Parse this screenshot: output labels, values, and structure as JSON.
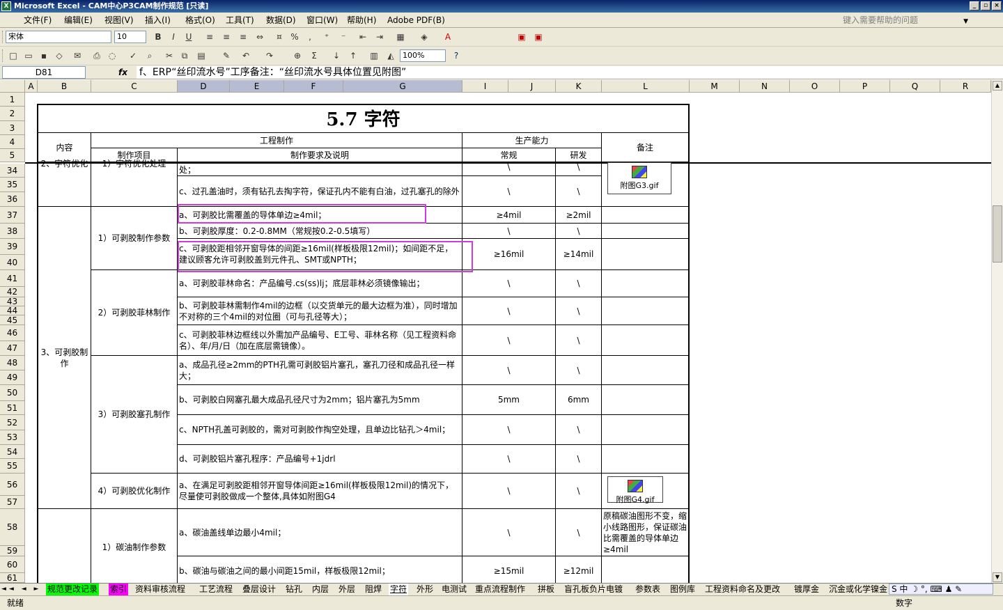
{
  "window": {
    "title": "Microsoft Excel - CAM中心P3CAM制作规范 [只读]",
    "min": "_",
    "max": "▫",
    "close": "×"
  },
  "menu": {
    "items": [
      "文件(F)",
      "编辑(E)",
      "视图(V)",
      "插入(I)",
      "格式(O)",
      "工具(T)",
      "数据(D)",
      "窗口(W)",
      "帮助(H)",
      "Adobe PDF(B)"
    ],
    "help_placeholder": "键入需要帮助的问题"
  },
  "format_toolbar": {
    "font": "宋体",
    "size": "10",
    "bold": "B",
    "italic": "I",
    "underline": "U",
    "percent": "%",
    "comma": ","
  },
  "std_toolbar": {
    "zoom": "100%"
  },
  "formula": {
    "cell": "D81",
    "fx": "fx",
    "content": "f、ERP“丝印流水号”工序备注：“丝印流水号具体位置见附图”"
  },
  "columns": [
    "A",
    "B",
    "C",
    "D",
    "E",
    "F",
    "G",
    "I",
    "J",
    "K",
    "L",
    "M",
    "N",
    "O",
    "P",
    "Q",
    "R"
  ],
  "rows": [
    "1",
    "2",
    "3",
    "4",
    "5",
    "34",
    "35",
    "36",
    "37",
    "38",
    "39",
    "40",
    "41",
    "42",
    "43",
    "44",
    "45",
    "46",
    "47",
    "48",
    "49",
    "50",
    "51",
    "52",
    "53",
    "54",
    "55",
    "56",
    "57",
    "58",
    "59",
    "60",
    "61"
  ],
  "sheet": {
    "title": "5.7 字符",
    "hdr_content": "内容",
    "hdr_eng": "工程制作",
    "hdr_capacity": "生产能力",
    "hdr_remark": "备注",
    "hdr_item": "制作项目",
    "hdr_req": "制作要求及说明",
    "hdr_normal": "常规",
    "hdr_dev": "研发",
    "partial_b": "2、字符优化",
    "partial_c": "1）字符优化处理",
    "r34_req": "处；",
    "r34_n": "\\",
    "r34_d": "\\",
    "r35_req": "c、过孔盖油时，须有钻孔去掏字符，保证孔内不能有白油，过孔塞孔的除外",
    "r35_n": "\\",
    "r35_d": "\\",
    "attach_g3": "附图G3.gif",
    "sec3": "3、可剥胶制作",
    "item1": "1）可剥胶制作参数",
    "r37_req": "a、可剥胶比需覆盖的导体单边≥4mil；",
    "r37_n": "≥4mil",
    "r37_d": "≥2mil",
    "r38_req": "b、可剥胶厚度：0.2-0.8MM（常规按0.2-0.5填写）",
    "r38_n": "\\",
    "r38_d": "\\",
    "r39_req": "c、可剥胶距相邻开窗导体的间距≥16mil(样板极限12mil)；如间距不足，建议顾客允许可剥胶盖到元件孔、SMT或NPTH；",
    "r39_n": "≥16mil",
    "r39_d": "≥14mil",
    "item2": "2）可剥胶菲林制作",
    "r41_req": "a、可剥胶菲林命名：产品编号.cs(ss)lj；底层菲林必须镜像输出；",
    "r41_n": "\\",
    "r41_d": "\\",
    "r44_req": "b、可剥胶菲林需制作4mil的边框（以交货单元的最大边框为准），同时增加不对称的三个4mil的对位圈（可与孔径等大）；",
    "r44_n": "\\",
    "r44_d": "\\",
    "r46_req": "c、可剥胶菲林边框线以外需加产品编号、E工号、菲林名称（见工程资料命名）、年/月/日（加在底层需镜像）。",
    "r46_n": "\\",
    "r46_d": "\\",
    "item3": "3）可剥胶塞孔制作",
    "r48_req": "a、成品孔径≥2mm的PTH孔需可剥胶铝片塞孔，塞孔刀径和成品孔径一样大；",
    "r48_n": "\\",
    "r48_d": "\\",
    "r50_req": "b、可剥胶白网塞孔最大成品孔径尺寸为2mm；铝片塞孔为5mm",
    "r50_n": "5mm",
    "r50_d": "6mm",
    "r52_req": "c、NPTH孔盖可剥胶的，需对可剥胶作掏空处理，且单边比钻孔＞4mil；",
    "r52_n": "\\",
    "r52_d": "\\",
    "r54_req": "d、可剥胶铝片塞孔程序：产品编号+1jdrl",
    "r54_n": "\\",
    "r54_d": "\\",
    "item4": "4）可剥胶优化制作",
    "r56_req": "a、在满足可剥胶距相邻开窗导体间距≥16mil(样板极限12mil)的情况下，尽量使可剥胶做成一个整体,具体如附图G4",
    "r56_n": "\\",
    "r56_d": "\\",
    "attach_g4": "附图G4.gif",
    "item5": "1）碳油制作参数",
    "r58_req": "a、碳油盖线单边最小4mil；",
    "r58_n": "\\",
    "r58_d": "\\",
    "r58_remark": "原稿碳油图形不变，缩小线路图形，保证碳油比需覆盖的导体单边≥4mil",
    "r60_req": "b、碳油与碳油之间的最小间距15mil，样板极限12mil；",
    "r60_n": "≥15mil",
    "r60_d": "≥12mil"
  },
  "tabs": [
    "规范更改记录",
    "索引",
    "资料审核流程",
    "工艺流程",
    "叠层设计",
    "钻孔",
    "内层",
    "外层",
    "阻焊",
    "字符",
    "外形",
    "电测试",
    "重点流程制作",
    "拼板",
    "盲孔板负片电镀",
    "参数表",
    "图例库",
    "工程资料命名及更改",
    "镀厚金",
    "沉金或化学镍金"
  ],
  "tab_nav": "◄◄ ◄ ► ►►",
  "ime": "S 中 ☽ °, ⌨ ♟ ✎",
  "status": {
    "left": "就绪",
    "right": "数字"
  },
  "colors": {
    "highlight": "#d23ae0",
    "tab_green": "#00ff00",
    "tab_magenta": "#ff00ff"
  }
}
